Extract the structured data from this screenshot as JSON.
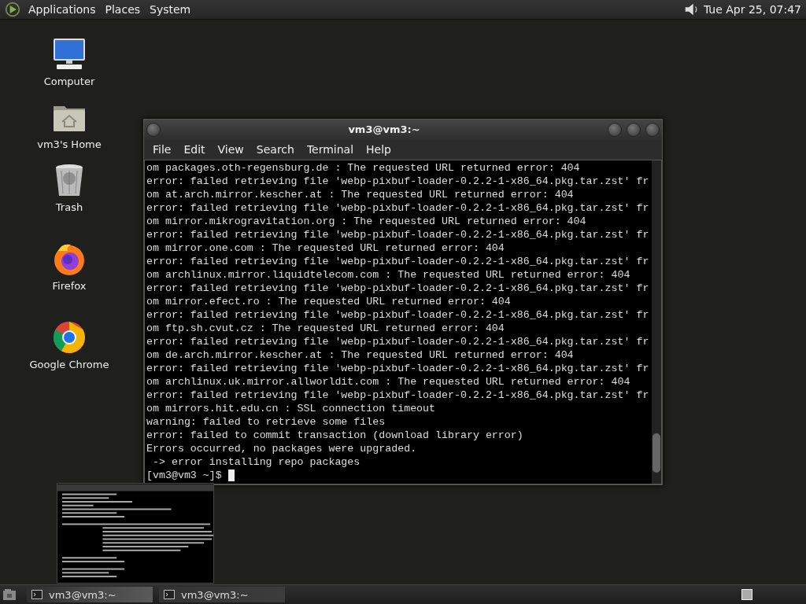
{
  "top_panel": {
    "menus": [
      "Applications",
      "Places",
      "System"
    ],
    "clock": "Tue Apr 25, 07:47"
  },
  "desktop_icons": [
    {
      "label": "Computer",
      "kind": "computer"
    },
    {
      "label": "vm3's Home",
      "kind": "home"
    },
    {
      "label": "Trash",
      "kind": "trash"
    },
    {
      "label": "Firefox",
      "kind": "firefox"
    },
    {
      "label": "Google Chrome",
      "kind": "chrome"
    }
  ],
  "terminal": {
    "title": "vm3@vm3:~",
    "menu": [
      "File",
      "Edit",
      "View",
      "Search",
      "Terminal",
      "Help"
    ],
    "lines": [
      "om packages.oth-regensburg.de : The requested URL returned error: 404",
      "error: failed retrieving file 'webp-pixbuf-loader-0.2.2-1-x86_64.pkg.tar.zst' fr",
      "om at.arch.mirror.kescher.at : The requested URL returned error: 404",
      "error: failed retrieving file 'webp-pixbuf-loader-0.2.2-1-x86_64.pkg.tar.zst' fr",
      "om mirror.mikrogravitation.org : The requested URL returned error: 404",
      "error: failed retrieving file 'webp-pixbuf-loader-0.2.2-1-x86_64.pkg.tar.zst' fr",
      "om mirror.one.com : The requested URL returned error: 404",
      "error: failed retrieving file 'webp-pixbuf-loader-0.2.2-1-x86_64.pkg.tar.zst' fr",
      "om archlinux.mirror.liquidtelecom.com : The requested URL returned error: 404",
      "error: failed retrieving file 'webp-pixbuf-loader-0.2.2-1-x86_64.pkg.tar.zst' fr",
      "om mirror.efect.ro : The requested URL returned error: 404",
      "error: failed retrieving file 'webp-pixbuf-loader-0.2.2-1-x86_64.pkg.tar.zst' fr",
      "om ftp.sh.cvut.cz : The requested URL returned error: 404",
      "error: failed retrieving file 'webp-pixbuf-loader-0.2.2-1-x86_64.pkg.tar.zst' fr",
      "om de.arch.mirror.kescher.at : The requested URL returned error: 404",
      "error: failed retrieving file 'webp-pixbuf-loader-0.2.2-1-x86_64.pkg.tar.zst' fr",
      "om archlinux.uk.mirror.allworldit.com : The requested URL returned error: 404",
      "error: failed retrieving file 'webp-pixbuf-loader-0.2.2-1-x86_64.pkg.tar.zst' fr",
      "om mirrors.hit.edu.cn : SSL connection timeout",
      "warning: failed to retrieve some files",
      "error: failed to commit transaction (download library error)",
      "Errors occurred, no packages were upgraded.",
      " -> error installing repo packages"
    ],
    "prompt": "[vm3@vm3 ~]$"
  },
  "window_preview": {
    "kind": "thumbnail"
  },
  "taskbar": {
    "tasks": [
      {
        "label": "vm3@vm3:~",
        "selected": true
      },
      {
        "label": "vm3@vm3:~",
        "selected": false
      }
    ]
  }
}
